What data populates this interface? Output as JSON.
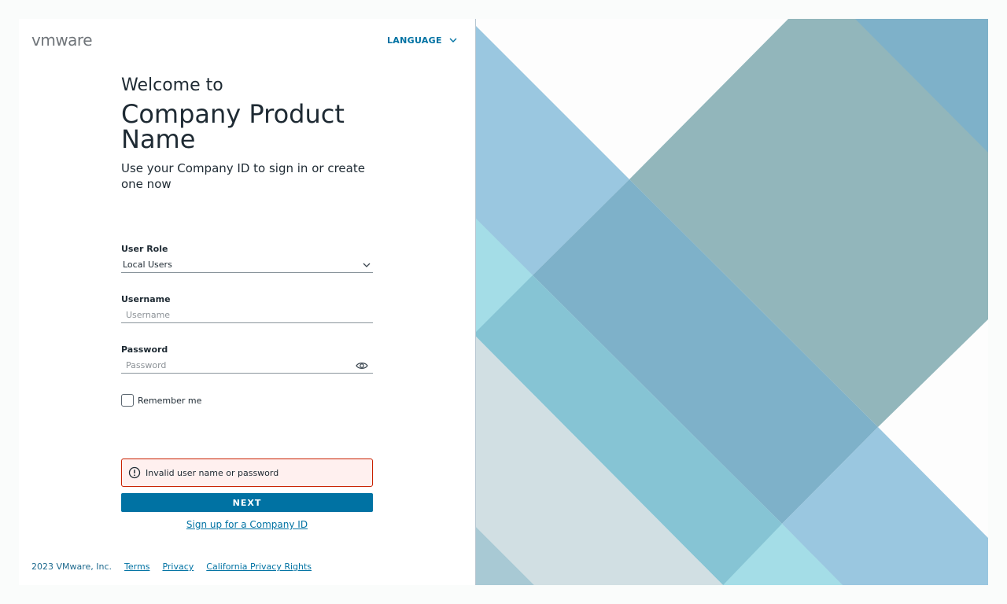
{
  "header": {
    "logo_text": "vmware",
    "language_label": "LANGUAGE"
  },
  "hero": {
    "welcome": "Welcome to",
    "product_name": "Company Product Name",
    "tagline": "Use your Company ID to sign in or create one now"
  },
  "form": {
    "user_role": {
      "label": "User Role",
      "value": "Local Users"
    },
    "username": {
      "label": "Username",
      "placeholder": "Username",
      "value": ""
    },
    "password": {
      "label": "Password",
      "placeholder": "Password",
      "value": ""
    },
    "remember_label": "Remember me",
    "remember_checked": false,
    "error_message": "Invalid user name or password",
    "next_label": "NEXT",
    "signup_label": "Sign up for a Company ID"
  },
  "footer": {
    "copyright": "2023 VMware, Inc.",
    "links": [
      "Terms",
      "Privacy",
      "California Privacy Rights"
    ]
  },
  "colors": {
    "accent": "#0072a3",
    "error_border": "#c92100",
    "error_bg": "#fff0ef",
    "text": "#1e2a33"
  },
  "icons": [
    "chevron-down-icon",
    "eye-icon",
    "error-circle-icon"
  ]
}
